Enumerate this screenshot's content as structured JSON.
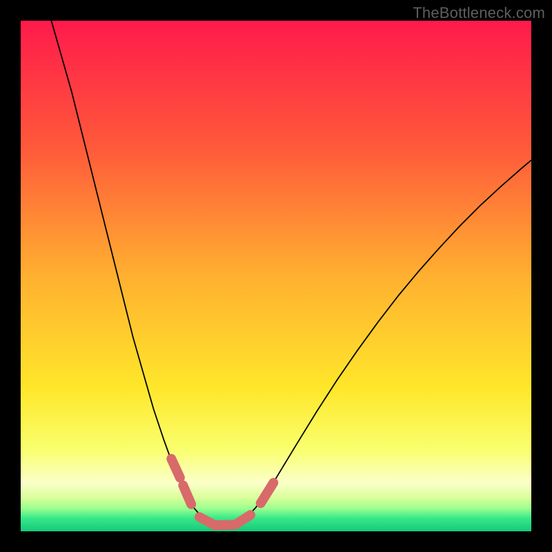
{
  "watermark": "TheBottleneck.com",
  "chart_data": {
    "type": "line",
    "title": "",
    "xlabel": "",
    "ylabel": "",
    "xlim": [
      0,
      100
    ],
    "ylim": [
      0,
      100
    ],
    "grid": false,
    "legend": false,
    "background": {
      "type": "vertical-gradient",
      "stops": [
        {
          "offset": 0.0,
          "color": "#ff1a4b"
        },
        {
          "offset": 0.25,
          "color": "#ff5a3a"
        },
        {
          "offset": 0.5,
          "color": "#ffb030"
        },
        {
          "offset": 0.72,
          "color": "#ffe72a"
        },
        {
          "offset": 0.84,
          "color": "#f9ff6e"
        },
        {
          "offset": 0.905,
          "color": "#fbffc8"
        },
        {
          "offset": 0.935,
          "color": "#d8ff9a"
        },
        {
          "offset": 0.955,
          "color": "#9cff8f"
        },
        {
          "offset": 0.975,
          "color": "#35e889"
        },
        {
          "offset": 1.0,
          "color": "#17c87a"
        }
      ]
    },
    "series": [
      {
        "name": "curve",
        "stroke": "#000000",
        "stroke_width": 1.8,
        "points": [
          {
            "x": 6.0,
            "y": 100.0
          },
          {
            "x": 8.0,
            "y": 93.0
          },
          {
            "x": 10.0,
            "y": 86.0
          },
          {
            "x": 12.0,
            "y": 78.0
          },
          {
            "x": 14.0,
            "y": 70.0
          },
          {
            "x": 16.0,
            "y": 62.0
          },
          {
            "x": 18.0,
            "y": 54.0
          },
          {
            "x": 20.0,
            "y": 46.0
          },
          {
            "x": 22.0,
            "y": 38.0
          },
          {
            "x": 24.0,
            "y": 31.0
          },
          {
            "x": 26.0,
            "y": 24.0
          },
          {
            "x": 28.0,
            "y": 18.0
          },
          {
            "x": 30.0,
            "y": 12.5
          },
          {
            "x": 32.0,
            "y": 8.0
          },
          {
            "x": 34.0,
            "y": 4.5
          },
          {
            "x": 36.0,
            "y": 2.2
          },
          {
            "x": 38.0,
            "y": 1.2
          },
          {
            "x": 40.0,
            "y": 1.0
          },
          {
            "x": 42.0,
            "y": 1.3
          },
          {
            "x": 44.0,
            "y": 2.5
          },
          {
            "x": 46.0,
            "y": 4.6
          },
          {
            "x": 48.0,
            "y": 7.3
          },
          {
            "x": 50.0,
            "y": 10.4
          },
          {
            "x": 54.0,
            "y": 17.0
          },
          {
            "x": 58.0,
            "y": 23.5
          },
          {
            "x": 62.0,
            "y": 29.7
          },
          {
            "x": 66.0,
            "y": 35.5
          },
          {
            "x": 70.0,
            "y": 41.0
          },
          {
            "x": 74.0,
            "y": 46.2
          },
          {
            "x": 78.0,
            "y": 51.0
          },
          {
            "x": 82.0,
            "y": 55.5
          },
          {
            "x": 86.0,
            "y": 59.8
          },
          {
            "x": 90.0,
            "y": 63.8
          },
          {
            "x": 94.0,
            "y": 67.5
          },
          {
            "x": 98.0,
            "y": 71.0
          },
          {
            "x": 100.0,
            "y": 72.7
          }
        ]
      },
      {
        "name": "segments-overlay",
        "stroke": "#d86a6a",
        "stroke_width": 14,
        "linecap": "round",
        "segments": [
          {
            "x1": 29.5,
            "y1": 14.2,
            "x2": 31.2,
            "y2": 10.5
          },
          {
            "x1": 31.8,
            "y1": 9.0,
            "x2": 33.4,
            "y2": 5.3
          },
          {
            "x1": 35.0,
            "y1": 2.8,
            "x2": 38.0,
            "y2": 1.2
          },
          {
            "x1": 38.0,
            "y1": 1.2,
            "x2": 42.0,
            "y2": 1.3
          },
          {
            "x1": 42.0,
            "y1": 1.3,
            "x2": 45.0,
            "y2": 3.2
          },
          {
            "x1": 47.0,
            "y1": 5.5,
            "x2": 49.5,
            "y2": 9.5
          }
        ]
      }
    ]
  }
}
